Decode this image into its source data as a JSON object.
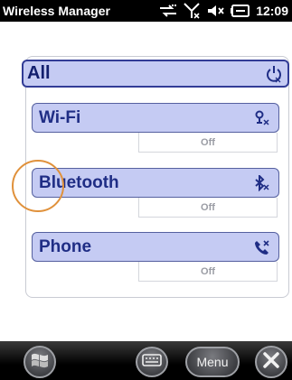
{
  "status_bar": {
    "title": "Wireless Manager",
    "time": "12:09",
    "icons": [
      "connectivity-icon",
      "signal-off-icon",
      "volume-off-icon",
      "battery-charging-icon"
    ]
  },
  "all_row": {
    "label": "All",
    "icon": "power-icon"
  },
  "radios": [
    {
      "label": "Wi-Fi",
      "state": "Off",
      "icon": "wifi-off-icon"
    },
    {
      "label": "Bluetooth",
      "state": "Off",
      "icon": "bluetooth-off-icon"
    },
    {
      "label": "Phone",
      "state": "Off",
      "icon": "phone-off-icon"
    }
  ],
  "bottom_bar": {
    "menu_label": "Menu",
    "icons": [
      "windows-start-icon",
      "keyboard-icon",
      "close-icon"
    ]
  },
  "colors": {
    "accent": "#323c96",
    "row_fill": "#c5cbf3",
    "focus_ring": "#e0913b"
  }
}
